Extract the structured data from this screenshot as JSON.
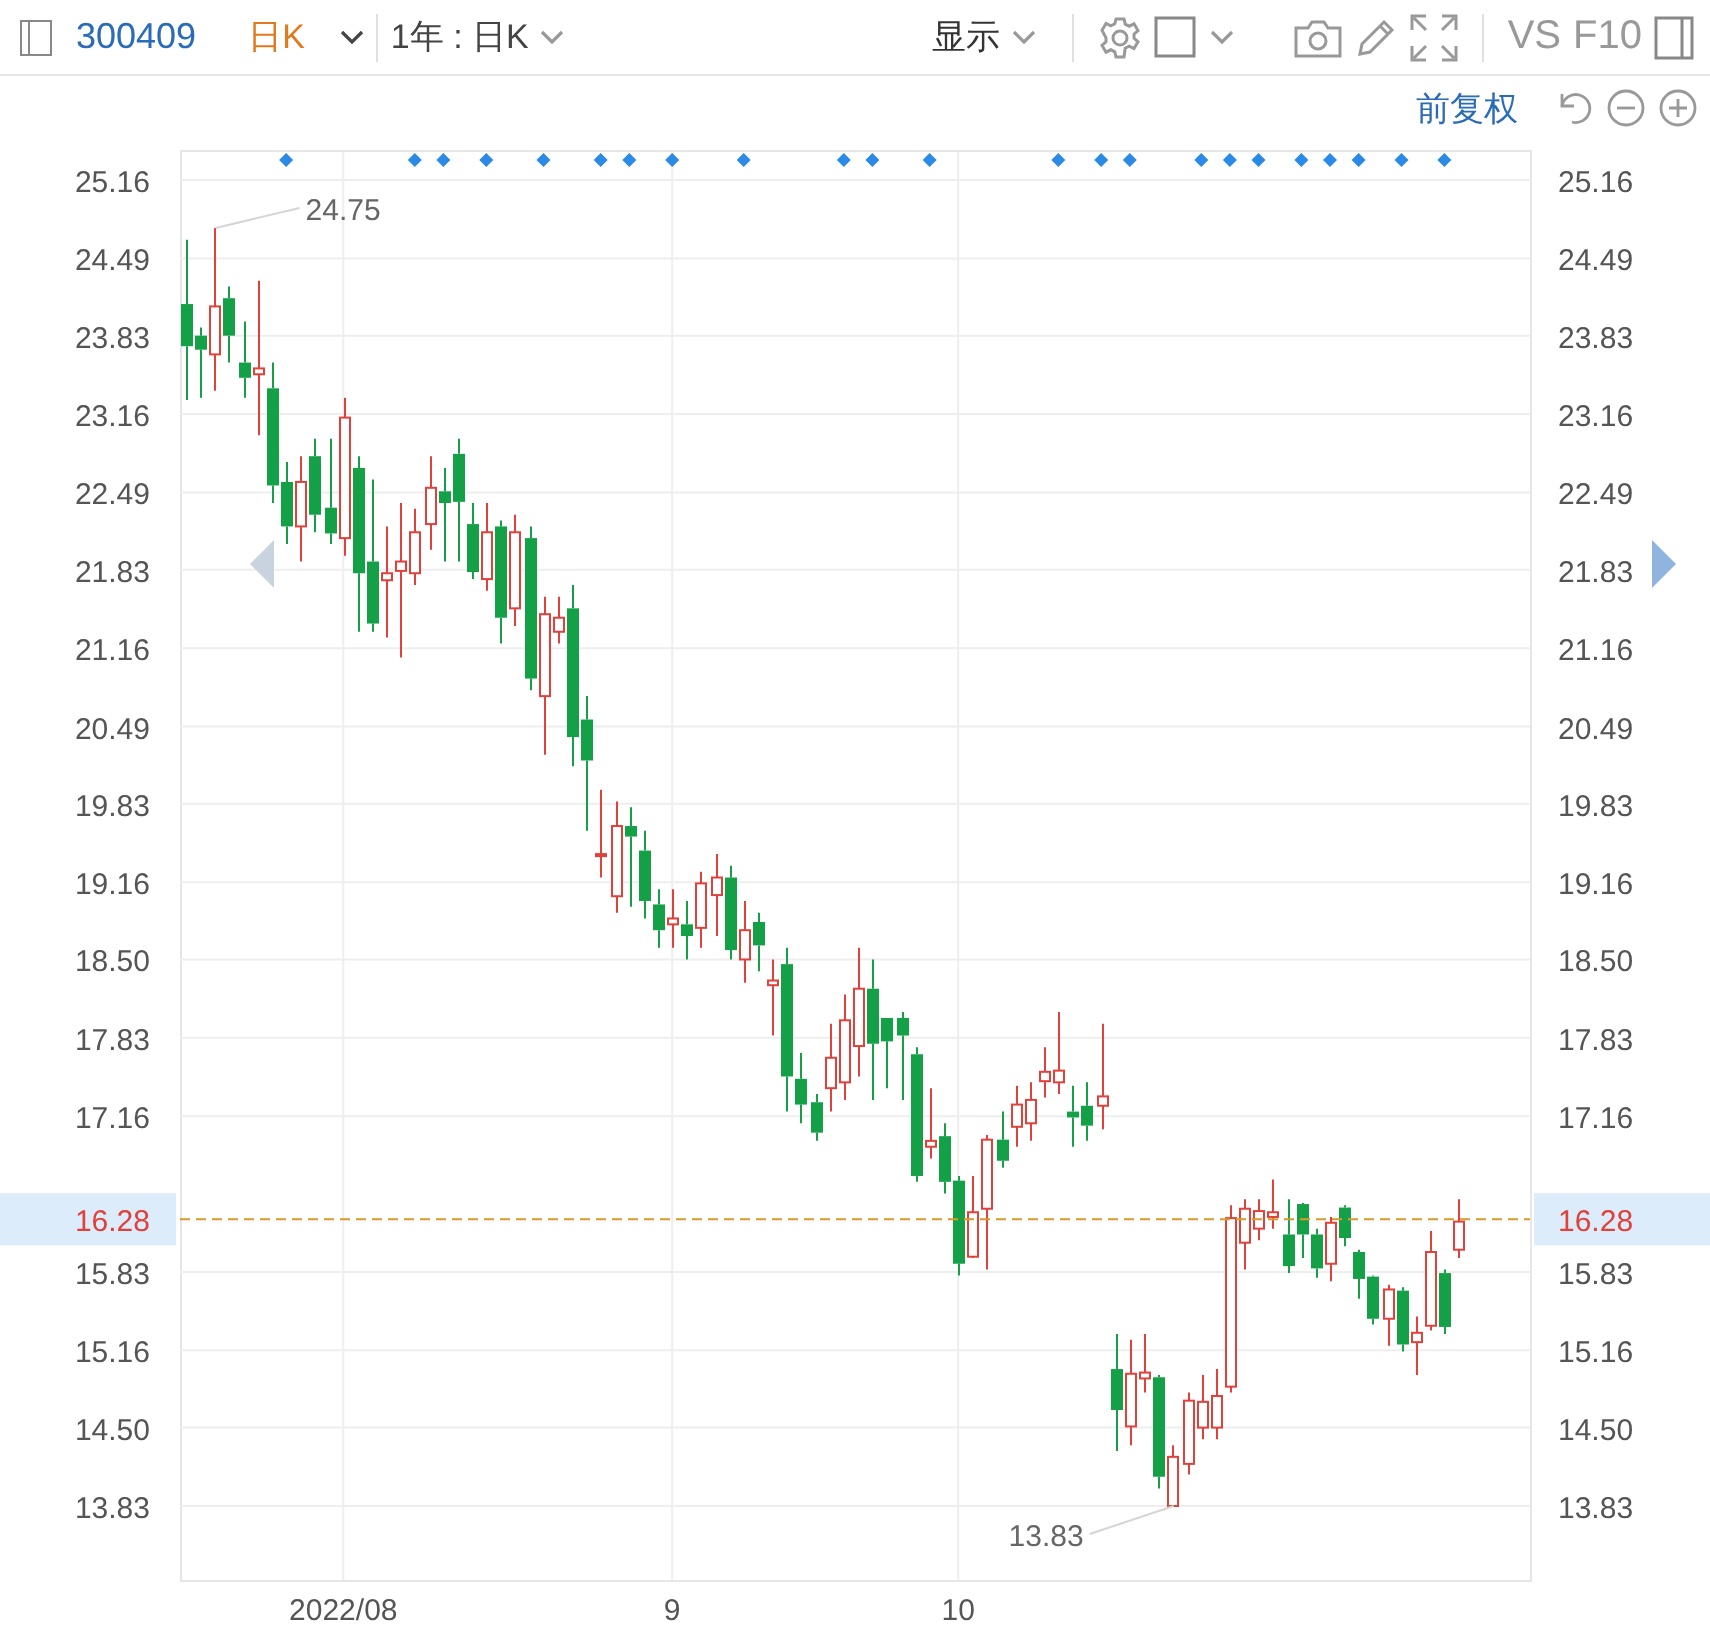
{
  "toolbar": {
    "symbol": "300409",
    "period": "日K",
    "range": "1年 : 日K",
    "display": "显示",
    "compare": "VS",
    "fundamentals": "F10"
  },
  "chart_controls": {
    "adjustment": "前复权"
  },
  "chart": {
    "chart_data": {
      "type": "candlestick",
      "grid": true,
      "categories": [
        null,
        null,
        null,
        null,
        null,
        null,
        null,
        null,
        null,
        null,
        null,
        "2022/08",
        null,
        null,
        null,
        null,
        null,
        null,
        null,
        null,
        null,
        null,
        null,
        null,
        null,
        null,
        null,
        null,
        null,
        null,
        null,
        null,
        null,
        null,
        "9",
        null,
        null,
        null,
        null,
        null,
        null,
        null,
        null,
        null,
        null,
        null,
        null,
        null,
        null,
        null,
        null,
        null,
        null,
        null,
        "10",
        null,
        null,
        null,
        null,
        null,
        null,
        null,
        null,
        null,
        null,
        null,
        null,
        null,
        null,
        null,
        null,
        null,
        null,
        null,
        null,
        null,
        null,
        null,
        null,
        null,
        null,
        null,
        null,
        null,
        null,
        null,
        null,
        null,
        null,
        null
      ],
      "ylim": [
        13.83,
        25.16
      ],
      "yticks": [
        25.16,
        24.49,
        23.83,
        23.16,
        22.49,
        21.83,
        21.16,
        20.49,
        19.83,
        19.16,
        {
          "value": 18.5,
          "label": "18.50"
        },
        17.83,
        17.16,
        15.83,
        15.16,
        {
          "value": 14.5,
          "label": "14.50"
        },
        13.83
      ],
      "ohlc": [
        [
          24.1,
          24.65,
          23.28,
          23.74
        ],
        [
          23.83,
          23.9,
          23.3,
          23.71
        ],
        [
          23.67,
          24.75,
          23.36,
          24.08
        ],
        [
          24.15,
          24.25,
          23.6,
          23.83
        ],
        [
          23.6,
          23.95,
          23.3,
          23.47
        ],
        [
          23.5,
          24.3,
          22.98,
          23.55
        ],
        [
          23.38,
          23.6,
          22.4,
          22.55
        ],
        [
          22.58,
          22.75,
          22.05,
          22.2
        ],
        [
          22.2,
          22.8,
          21.9,
          22.58
        ],
        [
          22.8,
          22.95,
          22.15,
          22.3
        ],
        [
          22.36,
          22.95,
          22.05,
          22.14
        ],
        [
          22.1,
          23.3,
          21.95,
          23.13
        ],
        [
          22.7,
          22.8,
          21.3,
          21.8
        ],
        [
          21.9,
          22.6,
          21.3,
          21.37
        ],
        [
          21.74,
          22.2,
          21.25,
          21.8
        ],
        [
          21.82,
          22.4,
          21.08,
          21.9
        ],
        [
          21.8,
          22.35,
          21.7,
          22.15
        ],
        [
          22.22,
          22.8,
          22.0,
          22.53
        ],
        [
          22.5,
          22.7,
          21.9,
          22.4
        ],
        [
          22.82,
          22.95,
          21.9,
          22.41
        ],
        [
          22.22,
          22.4,
          21.75,
          21.81
        ],
        [
          21.75,
          22.4,
          21.65,
          22.15
        ],
        [
          22.2,
          22.25,
          21.2,
          21.42
        ],
        [
          21.5,
          22.3,
          21.35,
          22.15
        ],
        [
          22.1,
          22.2,
          20.8,
          20.9
        ],
        [
          20.75,
          21.6,
          20.25,
          21.45
        ],
        [
          21.3,
          21.6,
          21.2,
          21.42
        ],
        [
          21.5,
          21.7,
          20.15,
          20.4
        ],
        [
          20.55,
          20.75,
          19.6,
          20.2
        ],
        [
          19.4,
          19.95,
          19.2,
          19.4
        ],
        [
          19.04,
          19.85,
          18.9,
          19.64
        ],
        [
          19.64,
          19.8,
          18.95,
          19.55
        ],
        [
          19.43,
          19.6,
          18.85,
          19.0
        ],
        [
          18.97,
          19.1,
          18.6,
          18.75
        ],
        [
          18.8,
          19.1,
          18.6,
          18.85
        ],
        [
          18.8,
          19.0,
          18.5,
          18.7
        ],
        [
          18.77,
          19.25,
          18.6,
          19.15
        ],
        [
          19.05,
          19.4,
          18.7,
          19.2
        ],
        [
          19.2,
          19.3,
          18.5,
          18.58
        ],
        [
          18.5,
          19.0,
          18.3,
          18.75
        ],
        [
          18.82,
          18.9,
          18.4,
          18.62
        ],
        [
          18.28,
          18.5,
          17.85,
          18.32
        ],
        [
          18.46,
          18.6,
          17.2,
          17.5
        ],
        [
          17.48,
          17.7,
          17.1,
          17.26
        ],
        [
          17.28,
          17.35,
          16.95,
          17.02
        ],
        [
          17.4,
          17.95,
          17.2,
          17.66
        ],
        [
          17.45,
          18.2,
          17.3,
          17.98
        ],
        [
          17.76,
          18.6,
          17.5,
          18.25
        ],
        [
          18.25,
          18.5,
          17.3,
          17.78
        ],
        [
          18.0,
          18.0,
          17.4,
          17.8
        ],
        [
          18.0,
          18.05,
          17.3,
          17.85
        ],
        [
          17.69,
          17.75,
          16.6,
          16.65
        ],
        [
          16.9,
          17.4,
          16.8,
          16.95
        ],
        [
          16.99,
          17.1,
          16.5,
          16.6
        ],
        [
          16.61,
          16.65,
          15.8,
          15.9
        ],
        [
          15.96,
          16.65,
          15.95,
          16.34
        ],
        [
          16.37,
          17.0,
          15.85,
          16.96
        ],
        [
          16.96,
          17.2,
          16.72,
          16.78
        ],
        [
          17.07,
          17.42,
          16.9,
          17.26
        ],
        [
          17.1,
          17.45,
          16.95,
          17.3
        ],
        [
          17.46,
          17.75,
          17.32,
          17.54
        ],
        [
          17.45,
          18.05,
          17.35,
          17.55
        ],
        [
          17.2,
          17.42,
          16.9,
          17.15
        ],
        [
          17.25,
          17.45,
          16.95,
          17.08
        ],
        [
          17.25,
          17.95,
          17.05,
          17.33
        ],
        [
          15.0,
          15.3,
          14.3,
          14.65
        ],
        [
          14.51,
          15.25,
          14.35,
          14.96
        ],
        [
          14.92,
          15.3,
          14.8,
          14.97
        ],
        [
          14.93,
          14.95,
          13.98,
          14.08
        ],
        [
          13.83,
          14.35,
          13.83,
          14.25
        ],
        [
          14.19,
          14.8,
          14.1,
          14.73
        ],
        [
          14.5,
          14.95,
          14.4,
          14.72
        ],
        [
          14.5,
          15.0,
          14.4,
          14.77
        ],
        [
          14.85,
          16.4,
          14.8,
          16.29
        ],
        [
          16.08,
          16.45,
          15.85,
          16.37
        ],
        [
          16.2,
          16.45,
          16.1,
          16.35
        ],
        [
          16.3,
          16.62,
          16.2,
          16.34
        ],
        [
          16.15,
          16.45,
          15.82,
          15.88
        ],
        [
          16.41,
          16.42,
          15.95,
          16.15
        ],
        [
          16.15,
          16.2,
          15.78,
          15.86
        ],
        [
          15.9,
          16.3,
          15.75,
          16.25
        ],
        [
          16.38,
          16.4,
          16.05,
          16.12
        ],
        [
          16.0,
          16.02,
          15.6,
          15.77
        ],
        [
          15.79,
          15.8,
          15.38,
          15.43
        ],
        [
          15.43,
          15.72,
          15.2,
          15.68
        ],
        [
          15.67,
          15.7,
          15.15,
          15.21
        ],
        [
          15.23,
          15.45,
          14.95,
          15.31
        ],
        [
          15.37,
          16.18,
          15.33,
          16.0
        ],
        [
          15.82,
          15.85,
          15.3,
          15.36
        ],
        [
          16.02,
          16.45,
          15.95,
          16.26
        ]
      ],
      "annotations": [
        "24.75",
        "13.83"
      ],
      "ref_lines": [
        {
          "axis": "y",
          "value": 16.28,
          "label": "16.28"
        }
      ]
    },
    "right_axis_labels": [
      "25.16",
      "24.49",
      "23.83",
      "23.16",
      "22.49",
      "21.83",
      "21.16",
      "20.49",
      "19.83",
      "19.16",
      "18.50",
      "17.83",
      "17.16",
      "15.83",
      "15.16",
      "14.50",
      "13.83"
    ],
    "right_price_tag": "16.28"
  }
}
